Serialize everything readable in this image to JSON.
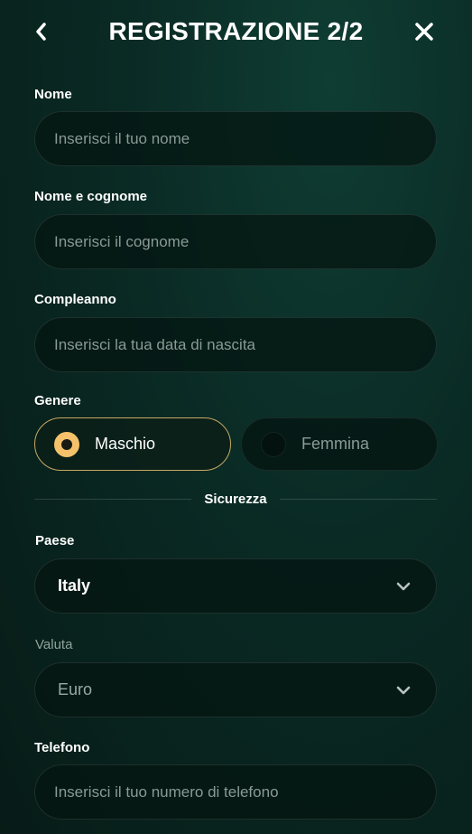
{
  "header": {
    "title": "REGISTRAZIONE 2/2",
    "back_icon": "chevron-left-icon",
    "close_icon": "close-icon"
  },
  "form": {
    "nome": {
      "label": "Nome",
      "placeholder": "Inserisci il tuo nome"
    },
    "cognome": {
      "label": "Nome e cognome",
      "placeholder": "Inserisci il cognome"
    },
    "compleanno": {
      "label": "Compleanno",
      "placeholder": "Inserisci la tua data di nascita"
    },
    "genere": {
      "label": "Genere",
      "options": [
        {
          "label": "Maschio",
          "selected": true
        },
        {
          "label": "Femmina",
          "selected": false
        }
      ]
    },
    "section_title": "Sicurezza",
    "paese": {
      "label": "Paese",
      "value": "Italy"
    },
    "valuta": {
      "label": "Valuta",
      "value": "Euro"
    },
    "telefono": {
      "label": "Telefono",
      "placeholder": "Inserisci il tuo numero di telefono"
    }
  },
  "colors": {
    "accent": "#f5c26b",
    "selected_border": "#c8a862",
    "background": "#0a2a24"
  }
}
